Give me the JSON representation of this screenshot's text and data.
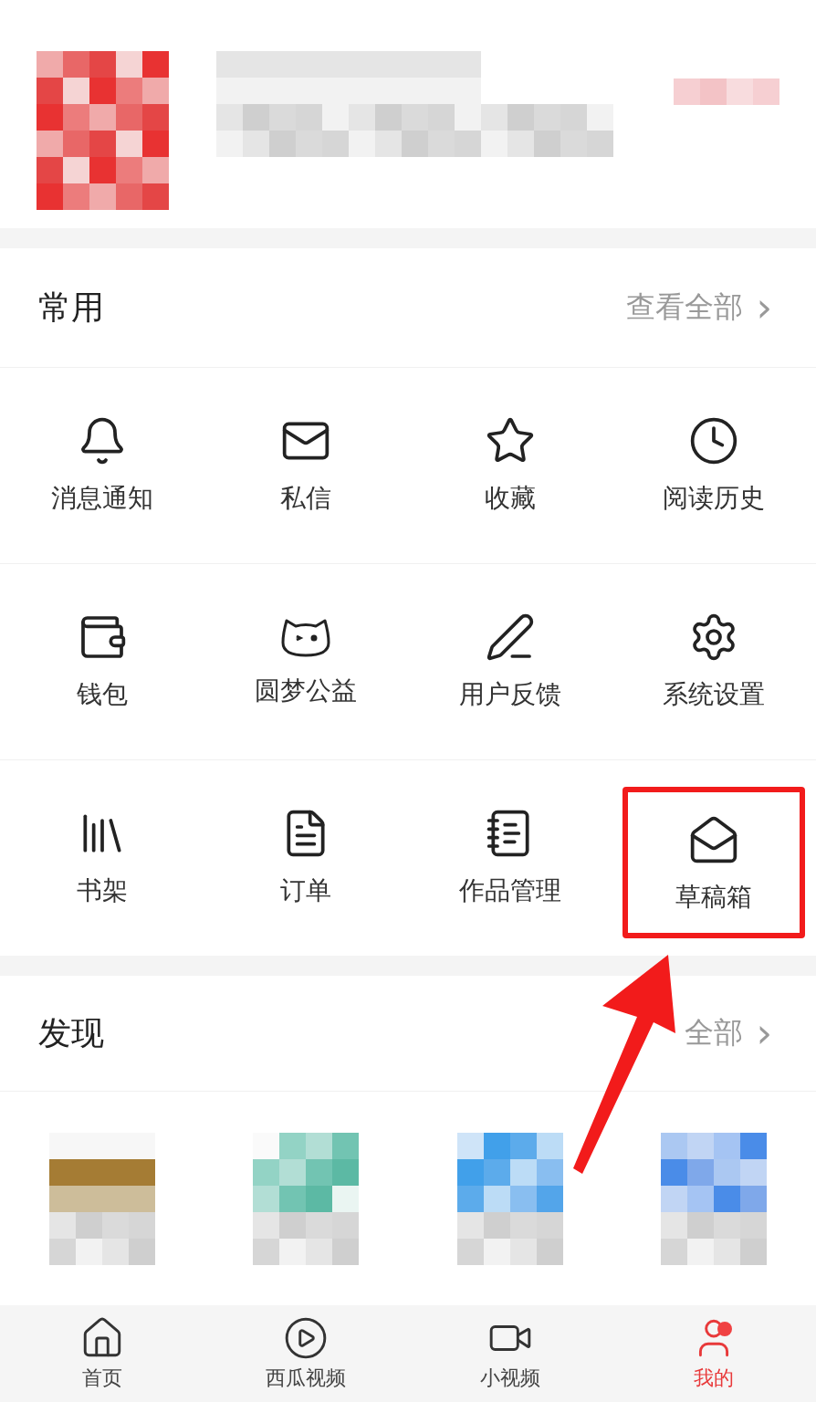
{
  "common": {
    "title": "常用",
    "view_all": "查看全部",
    "chevron": "›",
    "items": [
      {
        "label": "消息通知",
        "highlighted": false
      },
      {
        "label": "私信",
        "highlighted": false
      },
      {
        "label": "收藏",
        "highlighted": false
      },
      {
        "label": "阅读历史",
        "highlighted": false
      },
      {
        "label": "钱包",
        "highlighted": false
      },
      {
        "label": "圆梦公益",
        "highlighted": false
      },
      {
        "label": "用户反馈",
        "highlighted": false
      },
      {
        "label": "系统设置",
        "highlighted": false
      },
      {
        "label": "书架",
        "highlighted": false
      },
      {
        "label": "订单",
        "highlighted": false
      },
      {
        "label": "作品管理",
        "highlighted": false
      },
      {
        "label": "草稿箱",
        "highlighted": true
      }
    ]
  },
  "discover": {
    "title": "发现",
    "view_all": "全部",
    "chevron": "›"
  },
  "tabs": [
    {
      "label": "首页",
      "selected": false,
      "dot": false
    },
    {
      "label": "西瓜视频",
      "selected": false,
      "dot": false
    },
    {
      "label": "小视频",
      "selected": false,
      "dot": false
    },
    {
      "label": "我的",
      "selected": true,
      "dot": true
    }
  ]
}
